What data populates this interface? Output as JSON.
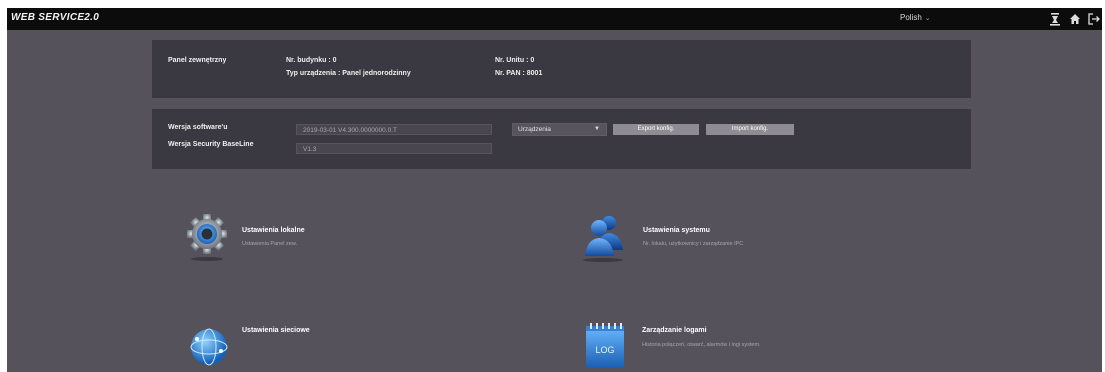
{
  "app": {
    "brand": "WEB SERVICE2.0"
  },
  "topbar": {
    "language": "Polish",
    "icons": [
      "user-tool-icon",
      "home-icon",
      "logout-icon"
    ]
  },
  "info_panel": {
    "device_label": "Panel zewnętrzny",
    "building_no": "Nr. budynku : 0",
    "device_type": "Typ urządzenia : Panel jednorodzinny",
    "unit_no": "Nr. Unitu : 0",
    "pan_no": "Nr. PAN : 8001"
  },
  "version_panel": {
    "software_label": "Wersja software'u",
    "software_value": "2019-03-01 V4.300.0000000.0.T",
    "baseline_label": "Wersja Security BaseLine",
    "baseline_value": "V1.3",
    "select_value": "Urządzenia",
    "export_label": "Export konfig.",
    "import_label": "Import konfig."
  },
  "cards": {
    "local": {
      "title": "Ustawienia lokalne",
      "desc": "Ustawienia Panel zew."
    },
    "system": {
      "title": "Ustawienia systemu",
      "desc": "Nr. lokalu, użytkownicy i zarządzanie IPC"
    },
    "network": {
      "title": "Ustawienia sieciowe"
    },
    "log": {
      "title": "Zarządzanie logami",
      "desc": "Historia połączeń, otwarć, alarmów i logi system.",
      "icon_text": "LOG"
    }
  },
  "colors": {
    "background": "#55525b",
    "topbar": "#0c0c0d",
    "panel": "#3a3841",
    "button": "#8e8b92"
  }
}
